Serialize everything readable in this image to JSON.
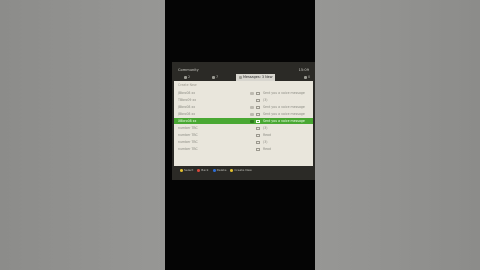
{
  "header": {
    "title": "Community",
    "clock": "15:09"
  },
  "tabs": [
    {
      "label": "2"
    },
    {
      "label": "7"
    },
    {
      "label": "Messages: 3 New"
    },
    {
      "label": "0"
    }
  ],
  "list": {
    "create_label": "Create New",
    "rows": [
      {
        "name": "JBbro08 xx",
        "message": "Sent you a voice message",
        "selected": false
      },
      {
        "name": "TBbro09 xx",
        "message": "(3)",
        "selected": false
      },
      {
        "name": "JBbro08 xx",
        "message": "Sent you a voice message",
        "selected": false
      },
      {
        "name": "JBbro08 xx",
        "message": "Sent you a voice message",
        "selected": false
      },
      {
        "name": "XBbro08 xx",
        "message": "Sent you a voice message",
        "selected": true
      },
      {
        "name": "number TBC",
        "message": "(3)",
        "selected": false
      },
      {
        "name": "number TBC",
        "message": "Read",
        "selected": false
      },
      {
        "name": "number TBC",
        "message": "(3)",
        "selected": false
      },
      {
        "name": "number TBC",
        "message": "Read",
        "selected": false
      }
    ]
  },
  "legend": [
    {
      "label": "Select",
      "color": "#e3c12f"
    },
    {
      "label": "Back",
      "color": "#d8473a"
    },
    {
      "label": "Delete",
      "color": "#2f6fd8"
    },
    {
      "label": "Create New",
      "color": "#e3c12f"
    }
  ]
}
